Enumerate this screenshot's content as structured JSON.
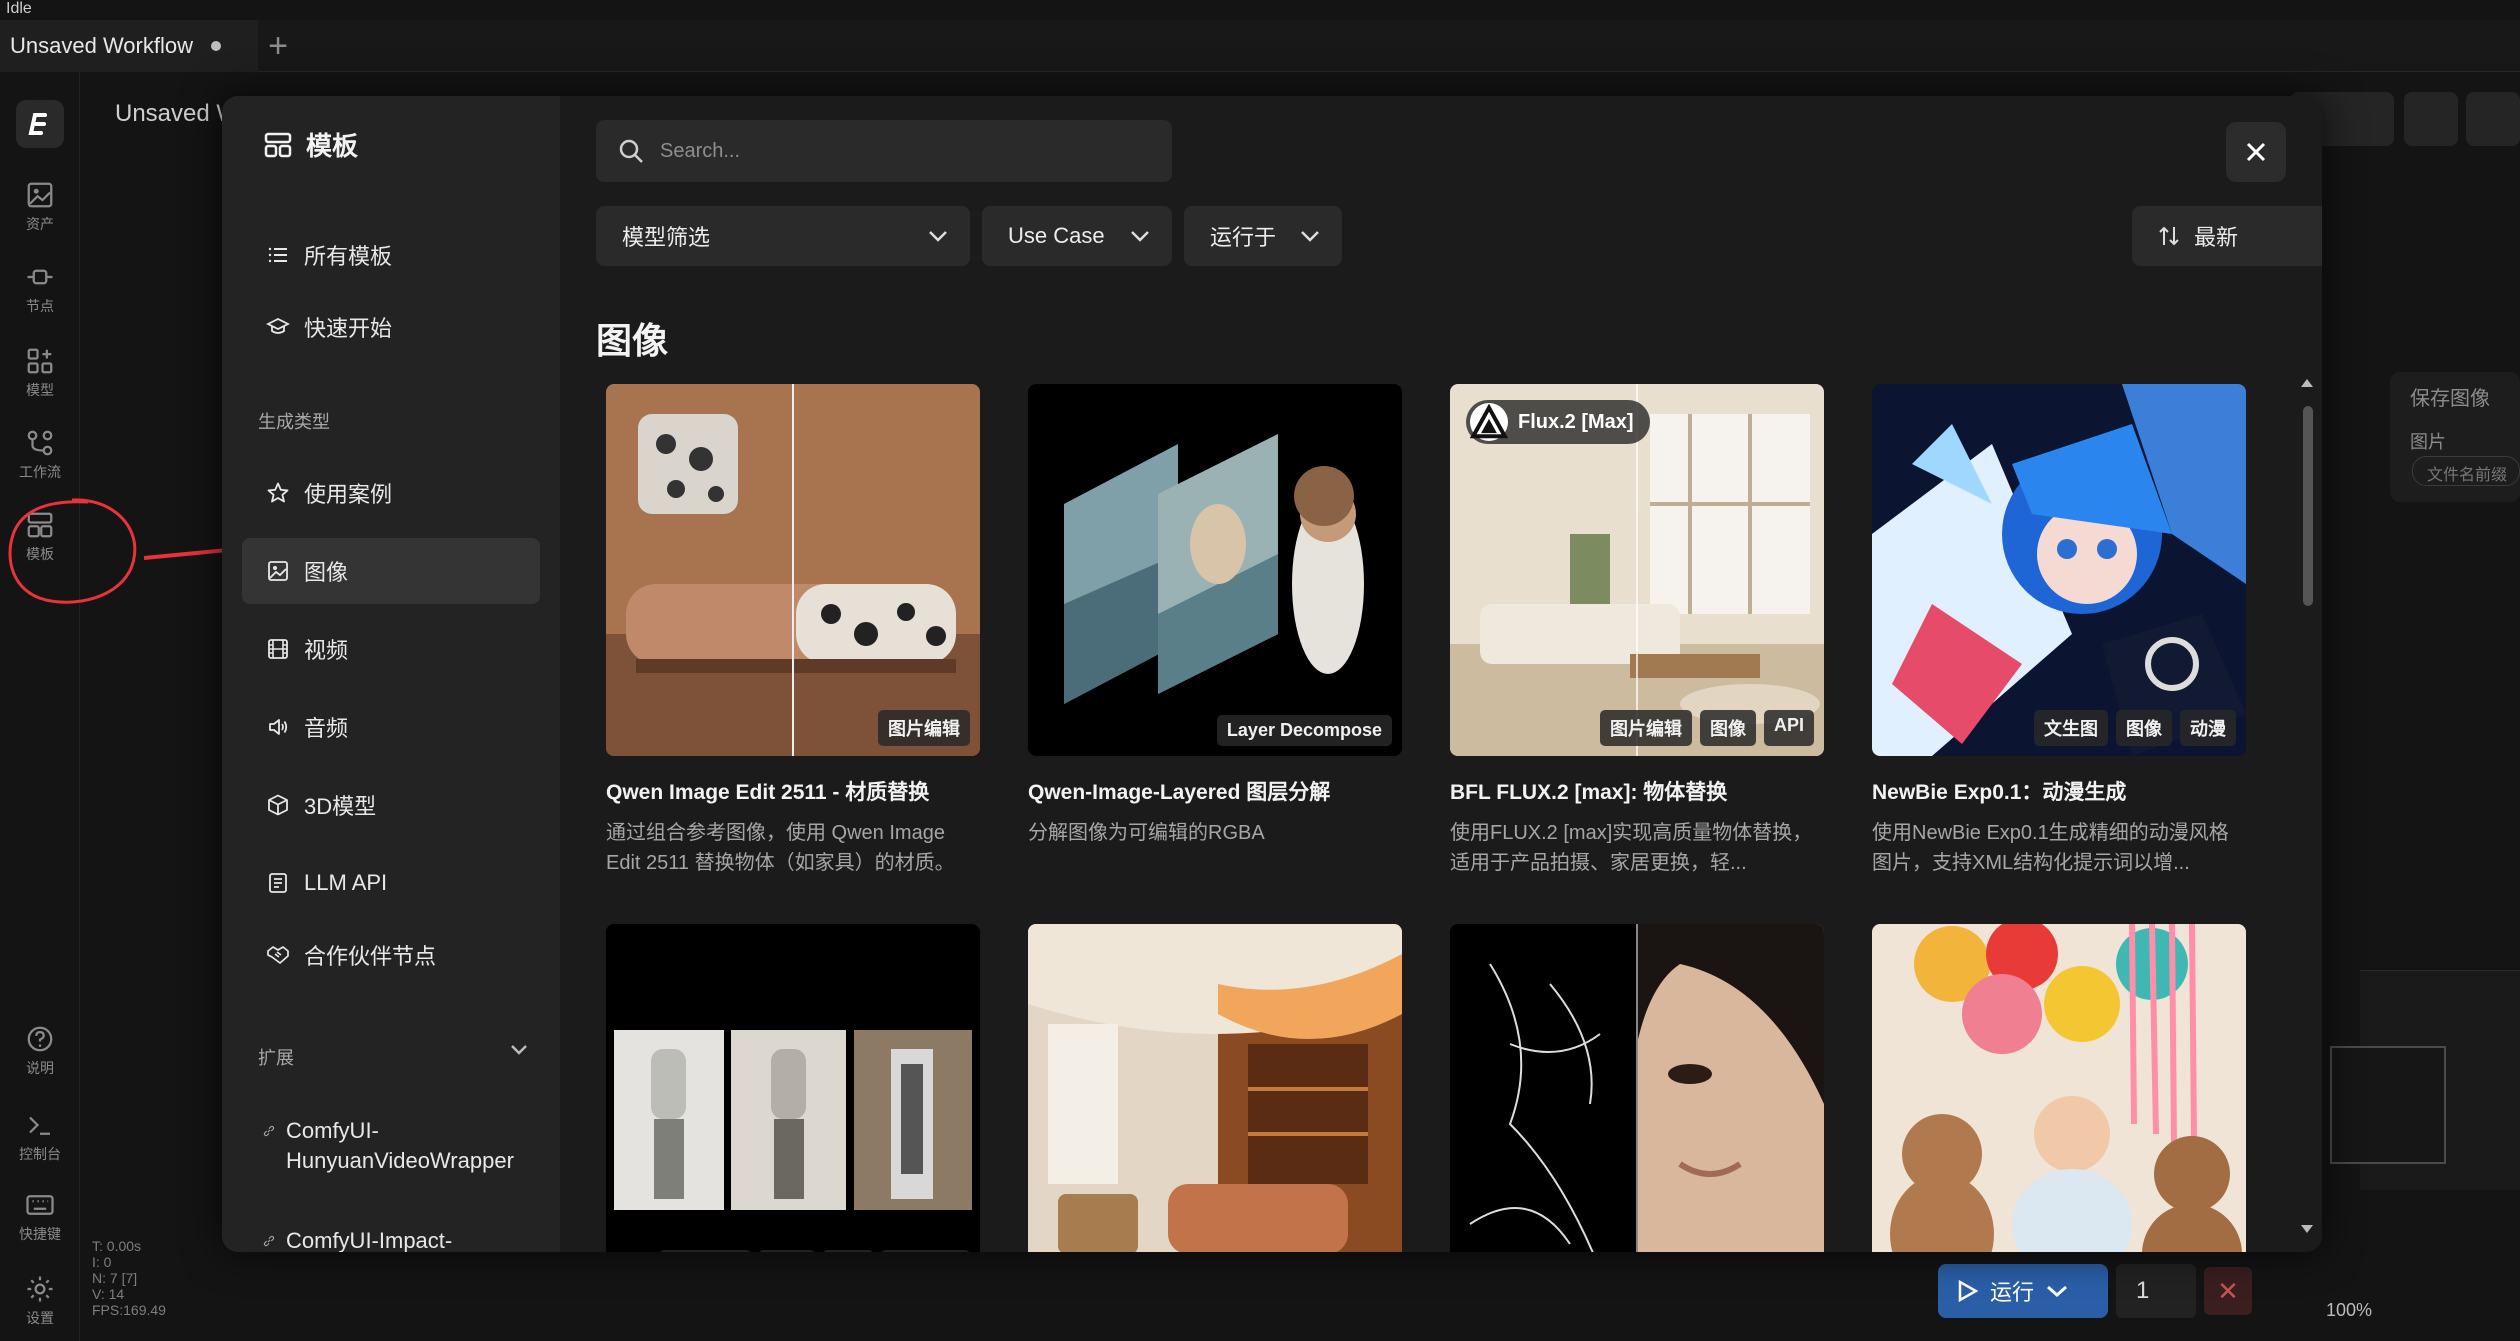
{
  "status": "Idle",
  "workflow_tab": {
    "title": "Unsaved Workflow"
  },
  "canvas": {
    "title": "Unsaved W"
  },
  "rail": [
    {
      "label": "资产",
      "icon": "image-icon"
    },
    {
      "label": "节点",
      "icon": "node-icon"
    },
    {
      "label": "模型",
      "icon": "model-icon"
    },
    {
      "label": "工作流",
      "icon": "workflow-icon"
    },
    {
      "label": "模板",
      "icon": "template-icon"
    },
    {
      "label": "说明",
      "icon": "help-icon"
    },
    {
      "label": "控制台",
      "icon": "terminal-icon"
    },
    {
      "label": "快捷键",
      "icon": "keyboard-icon"
    },
    {
      "label": "设置",
      "icon": "gear-icon"
    }
  ],
  "debug": [
    "T: 0.00s",
    "I: 0",
    "N: 7 [7]",
    "V: 14",
    "FPS:169.49"
  ],
  "bg_node": {
    "title": "保存图像",
    "port": "图片",
    "field": "文件名前缀"
  },
  "run": {
    "label": "运行",
    "quantity": "1"
  },
  "zoom": "100%",
  "modal": {
    "title": "模板",
    "nav": [
      {
        "label": "所有模板",
        "icon": "list-icon"
      },
      {
        "label": "快速开始",
        "icon": "graduation-icon"
      }
    ],
    "section_gen": "生成类型",
    "gen_types": [
      {
        "label": "使用案例",
        "icon": "star-icon"
      },
      {
        "label": "图像",
        "icon": "image-icon"
      },
      {
        "label": "视频",
        "icon": "film-icon"
      },
      {
        "label": "音频",
        "icon": "speaker-icon"
      },
      {
        "label": "3D模型",
        "icon": "cube-icon"
      },
      {
        "label": "LLM API",
        "icon": "document-icon"
      },
      {
        "label": "合作伙伴节点",
        "icon": "handshake-icon"
      }
    ],
    "section_ext": "扩展",
    "extensions": [
      "ComfyUI-HunyuanVideoWrapper",
      "ComfyUI-Impact-"
    ],
    "search_placeholder": "Search...",
    "filters": {
      "model": "模型筛选",
      "use_case": "Use Case",
      "runs_on": "运行于",
      "sort": "最新"
    },
    "section_heading": "图像",
    "cards": [
      {
        "title": "Qwen Image Edit 2511 - 材质替换",
        "desc": "通过组合参考图像，使用 Qwen Image Edit 2511 替换物体（如家具）的材质。",
        "tags": [
          "图片编辑"
        ],
        "badge": ""
      },
      {
        "title": "Qwen-Image-Layered 图层分解",
        "desc": "分解图像为可编辑的RGBA",
        "tags": [
          "Layer Decompose"
        ],
        "badge": ""
      },
      {
        "title": "BFL FLUX.2 [max]: 物体替换",
        "desc": "使用FLUX.2 [max]实现高质量物体替换，适用于产品拍摄、家居更换，轻...",
        "tags": [
          "图片编辑",
          "图像",
          "API"
        ],
        "badge": "Flux.2 [Max]"
      },
      {
        "title": "NewBie Exp0.1：动漫生成",
        "desc": "使用NewBie Exp0.1生成精细的动漫风格图片，支持XML结构化提示词以增...",
        "tags": [
          "文生图",
          "图像",
          "动漫"
        ],
        "badge": ""
      },
      {
        "title": "",
        "desc": "",
        "tags": [
          "图片编辑",
          "图像",
          "API",
          "Fashion"
        ],
        "badge": ""
      },
      {
        "title": "",
        "desc": "",
        "tags": [],
        "badge": ""
      },
      {
        "title": "",
        "desc": "",
        "tags": [],
        "badge": ""
      },
      {
        "title": "",
        "desc": "",
        "tags": [],
        "badge": ""
      }
    ]
  },
  "colors": {
    "accent_run": "#2a5fa8",
    "annotation": "#e8333a",
    "modal_bg": "#1b1b1b",
    "sidebar_bg": "#232323"
  }
}
